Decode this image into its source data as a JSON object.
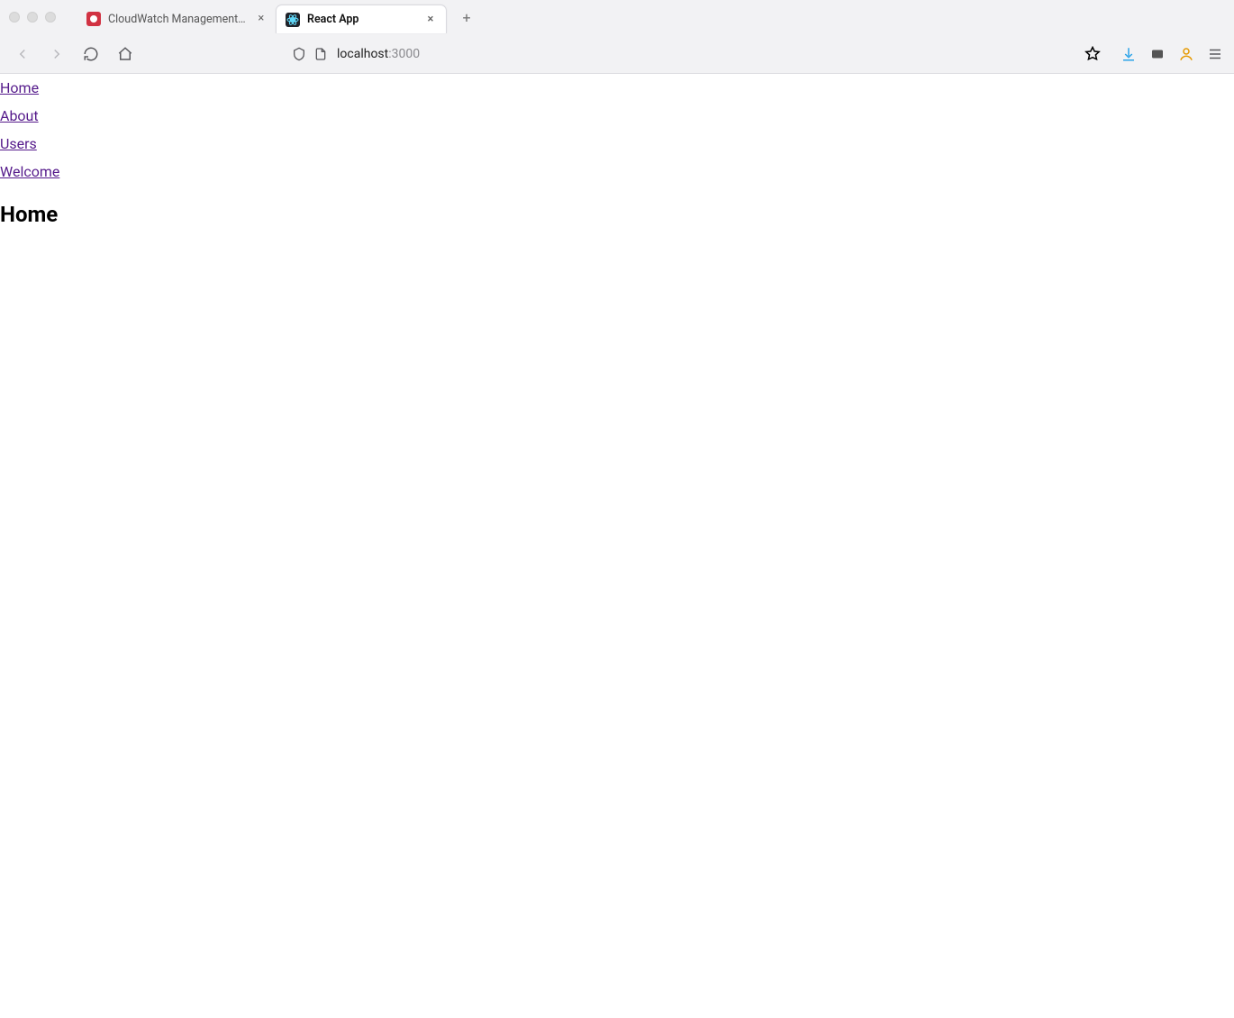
{
  "browser": {
    "tabs": [
      {
        "title": "CloudWatch Management Cons",
        "active": false
      },
      {
        "title": "React App",
        "active": true
      }
    ],
    "url_host": "localhost",
    "url_port": ":3000"
  },
  "page": {
    "nav": [
      {
        "label": "Home"
      },
      {
        "label": "About"
      },
      {
        "label": "Users"
      },
      {
        "label": "Welcome"
      }
    ],
    "heading": "Home"
  }
}
